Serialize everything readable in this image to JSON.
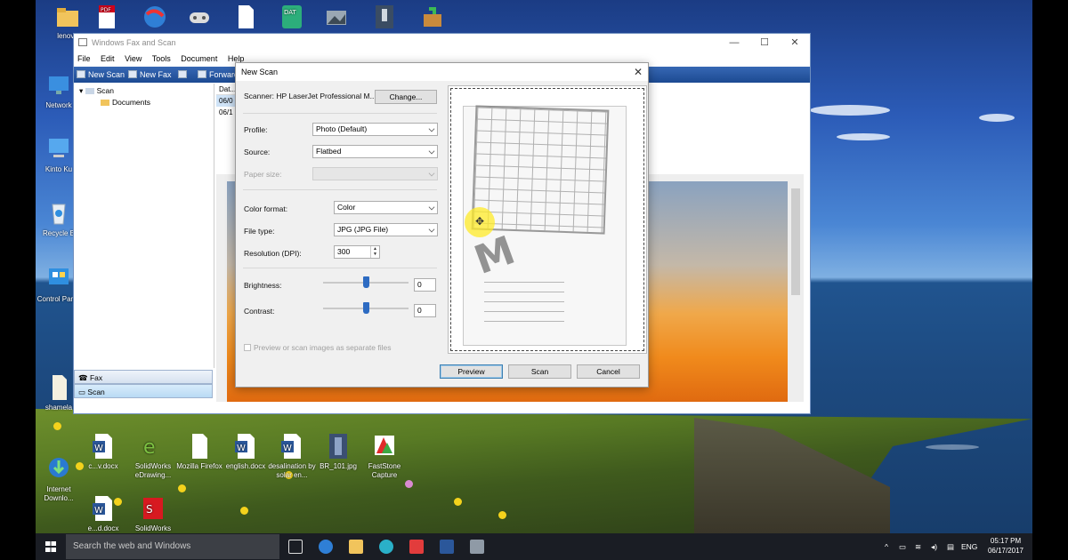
{
  "desktop": {
    "top_icons": [
      {
        "label": "lenovo",
        "icon": "folder-icon"
      },
      {
        "label": "",
        "icon": "pdf-icon"
      },
      {
        "label": "",
        "icon": "browser-icon"
      },
      {
        "label": "",
        "icon": "gamepad-icon"
      },
      {
        "label": "",
        "icon": "document-icon"
      },
      {
        "label": "",
        "icon": "dat-icon"
      },
      {
        "label": "",
        "icon": "image-icon"
      },
      {
        "label": "",
        "icon": "usb-icon"
      },
      {
        "label": "",
        "icon": "package-icon"
      }
    ],
    "left_icons": [
      {
        "label": "Network",
        "icon": "network-icon"
      },
      {
        "label": "Kinto Ku",
        "icon": "computer-icon"
      },
      {
        "label": "Recycle B",
        "icon": "recycle-bin-icon"
      },
      {
        "label": "Control Panel",
        "icon": "control-panel-icon"
      },
      {
        "label": "shamela",
        "icon": "file-icon"
      },
      {
        "label": "Internet Downlo...",
        "icon": "download-icon"
      }
    ],
    "bottom_icons": [
      {
        "label": "c...v.docx",
        "icon": "word-icon"
      },
      {
        "label": "SolidWorks eDrawing...",
        "icon": "edrawings-icon"
      },
      {
        "label": "Mozilla Firefox",
        "icon": "document-icon"
      },
      {
        "label": "english.docx",
        "icon": "word-icon"
      },
      {
        "label": "desalination by solar en...",
        "icon": "word-icon"
      },
      {
        "label": "BR_101.jpg",
        "icon": "jpg-icon"
      },
      {
        "label": "FastStone Capture",
        "icon": "faststone-icon"
      }
    ],
    "bottom_icons_row2": [
      {
        "label": "e...d.docx",
        "icon": "word-icon"
      },
      {
        "label": "SolidWorks",
        "icon": "solidworks-icon"
      }
    ]
  },
  "fax_scan": {
    "title": "Windows Fax and Scan",
    "menu": [
      "File",
      "Edit",
      "View",
      "Tools",
      "Document",
      "Help"
    ],
    "toolbar": {
      "new_scan": "New Scan",
      "new_fax": "New Fax",
      "forward": "Forward"
    },
    "tree": {
      "root": "Scan",
      "child": "Documents"
    },
    "list_header": "Dat...",
    "list_rows": [
      "06/0",
      "06/1"
    ],
    "nav": {
      "fax": "Fax",
      "scan": "Scan"
    }
  },
  "new_scan": {
    "title": "New Scan",
    "scanner_label": "Scanner: HP LaserJet Professional M...",
    "change_button": "Change...",
    "profile_label": "Profile:",
    "profile_value": "Photo (Default)",
    "source_label": "Source:",
    "source_value": "Flatbed",
    "paper_size_label": "Paper size:",
    "paper_size_value": "",
    "color_format_label": "Color format:",
    "color_format_value": "Color",
    "file_type_label": "File type:",
    "file_type_value": "JPG (JPG File)",
    "resolution_label": "Resolution (DPI):",
    "resolution_value": "300",
    "brightness_label": "Brightness:",
    "brightness_value": "0",
    "contrast_label": "Contrast:",
    "contrast_value": "0",
    "separate_files_label": "Preview or scan images as separate files",
    "preview_button": "Preview",
    "scan_button": "Scan",
    "cancel_button": "Cancel",
    "preview_mark_text": "M"
  },
  "taskbar": {
    "search_placeholder": "Search the web and Windows",
    "language": "ENG",
    "time": "05:17 PM",
    "date": "06/17/2017"
  },
  "colors": {
    "toolbar_blue": "#1c4a92",
    "taskbar_bg": "#1a1d24",
    "accent": "#2d6bc2"
  }
}
